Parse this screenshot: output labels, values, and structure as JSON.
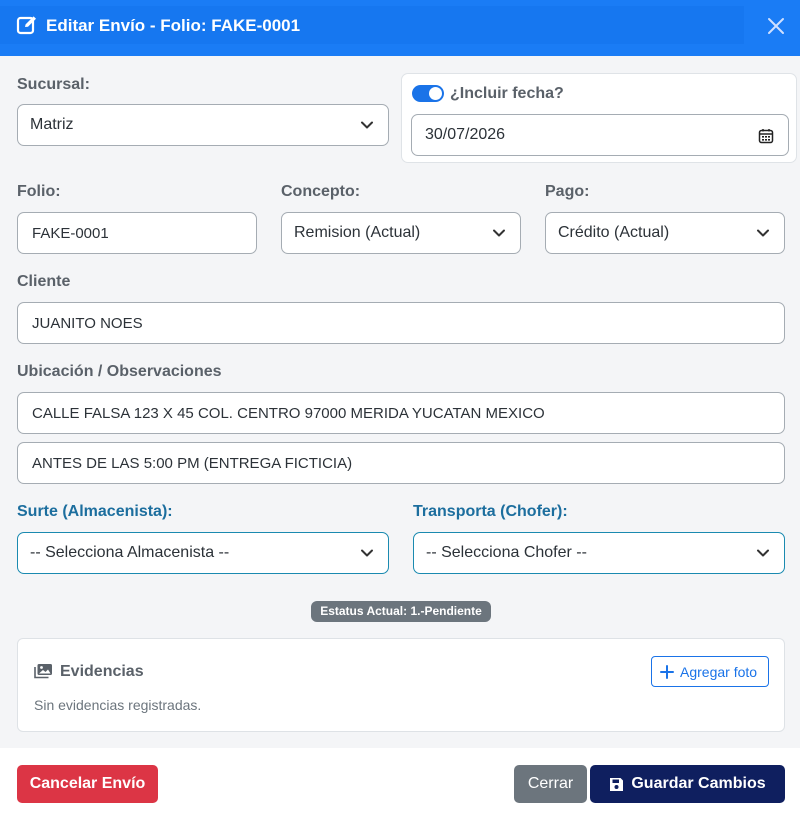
{
  "header": {
    "title": "Editar Envío - Folio: FAKE-0001"
  },
  "form": {
    "sucursal": {
      "label": "Sucursal:",
      "value": "Matriz"
    },
    "fecha": {
      "toggle_label": "¿Incluir fecha?",
      "enabled": true,
      "value": "30/07/2026"
    },
    "folio": {
      "label": "Folio:",
      "value": "FAKE-0001"
    },
    "concepto": {
      "label": "Concepto:",
      "value": "Remision (Actual)"
    },
    "pago": {
      "label": "Pago:",
      "value": "Crédito (Actual)"
    },
    "cliente": {
      "label": "Cliente",
      "value": "JUANITO NOES"
    },
    "ubicacion": {
      "label": "Ubicación / Observaciones",
      "direccion": "CALLE FALSA 123 X 45 COL. CENTRO 97000 MERIDA YUCATAN MEXICO",
      "observaciones": "ANTES DE LAS 5:00 PM (ENTREGA FICTICIA)"
    },
    "surte": {
      "label": "Surte (Almacenista):",
      "value": "-- Selecciona Almacenista --"
    },
    "transporta": {
      "label": "Transporta (Chofer):",
      "value": "-- Selecciona Chofer --"
    }
  },
  "status_badge": "Estatus Actual: 1.-Pendiente",
  "evidencias": {
    "title": "Evidencias",
    "empty_text": "Sin evidencias registradas.",
    "add_label": "Agregar foto"
  },
  "footer": {
    "cancel_label": "Cancelar Envío",
    "close_label": "Cerrar",
    "save_label": "Guardar Cambios"
  },
  "colors": {
    "header": "#1a7cf5",
    "cancel": "#dc3545",
    "close": "#6c757d",
    "save": "#0f1f5f",
    "accent": "#1a73e8"
  },
  "icons": {
    "title": "edit-icon",
    "close": "close-icon",
    "date": "calendar-icon",
    "evidencias": "images-icon",
    "add": "plus-icon",
    "save": "floppy-disk-icon",
    "select": "chevron-down-icon"
  }
}
